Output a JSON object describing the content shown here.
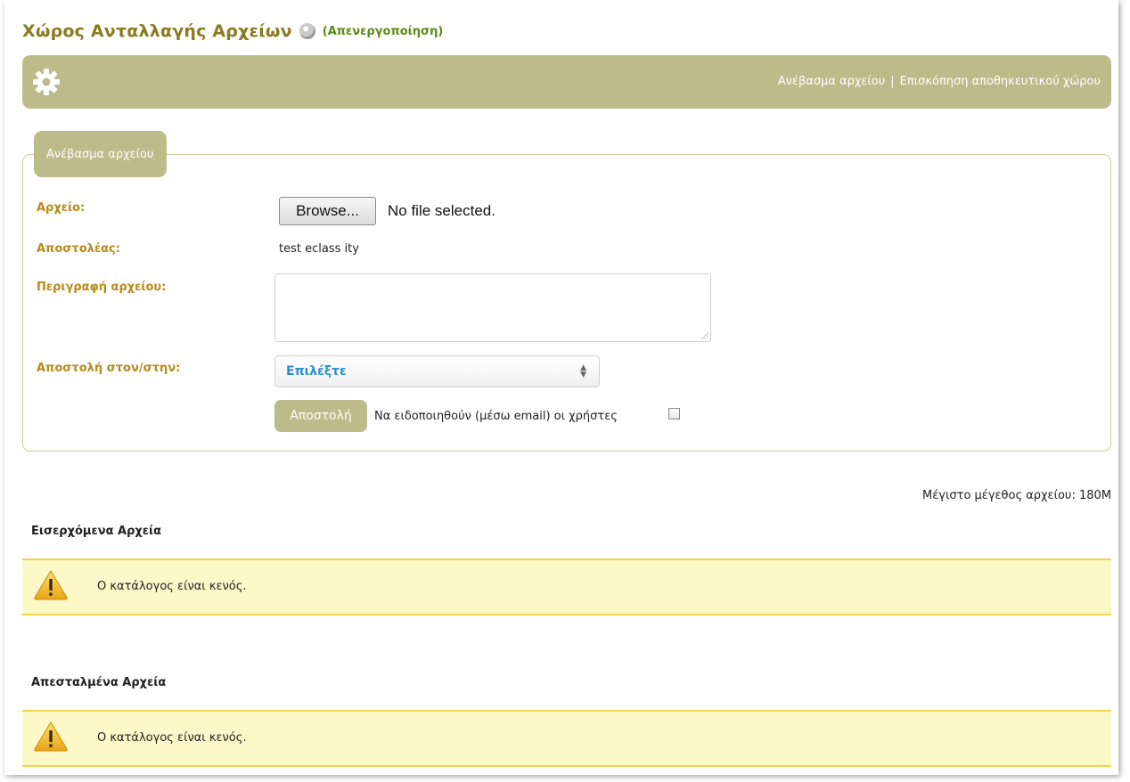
{
  "header": {
    "title": "Χώρος Ανταλλαγής Αρχείων",
    "status_icon": "toggle-status-icon",
    "deactivate_link": "(Απενεργοποίηση)"
  },
  "toolbar": {
    "icon": "gear-icon",
    "links": [
      "Ανέβασμα αρχείου",
      "Επισκόπηση αποθηκευτικού χώρου"
    ],
    "separator": "|"
  },
  "upload_form": {
    "legend": "Ανέβασμα αρχείου",
    "file_label": "Αρχείο:",
    "browse_button": "Browse...",
    "no_file_text": "No file selected.",
    "sender_label": "Αποστολέας:",
    "sender_value": "test eclass ity",
    "description_label": "Περιγραφή αρχείου:",
    "description_value": "",
    "recipient_label": "Αποστολή στον/στην:",
    "recipient_selected": "Επιλέξτε",
    "send_button": "Αποστολή",
    "notify_label": "Να ειδοποιηθούν (μέσω email) οι χρήστες",
    "notify_checked": false
  },
  "max_size_text": "Μέγιστο μέγεθος αρχείου: 180M",
  "incoming": {
    "title": "Εισερχόμενα Αρχεία",
    "empty_message": "Ο κατάλογος είναι κενός.",
    "icon": "warning-icon"
  },
  "sent": {
    "title": "Απεσταλμένα Αρχεία",
    "empty_message": "Ο κατάλογος είναι κενός.",
    "icon": "warning-icon"
  },
  "colors": {
    "accent_bar": "#bdbb8a",
    "title": "#8c7a1e",
    "label": "#b98a1a",
    "deactivate": "#5a8a12",
    "select_value": "#2f8fc9",
    "alert_bg": "#fcf8c8",
    "alert_border": "#f3d34e"
  }
}
